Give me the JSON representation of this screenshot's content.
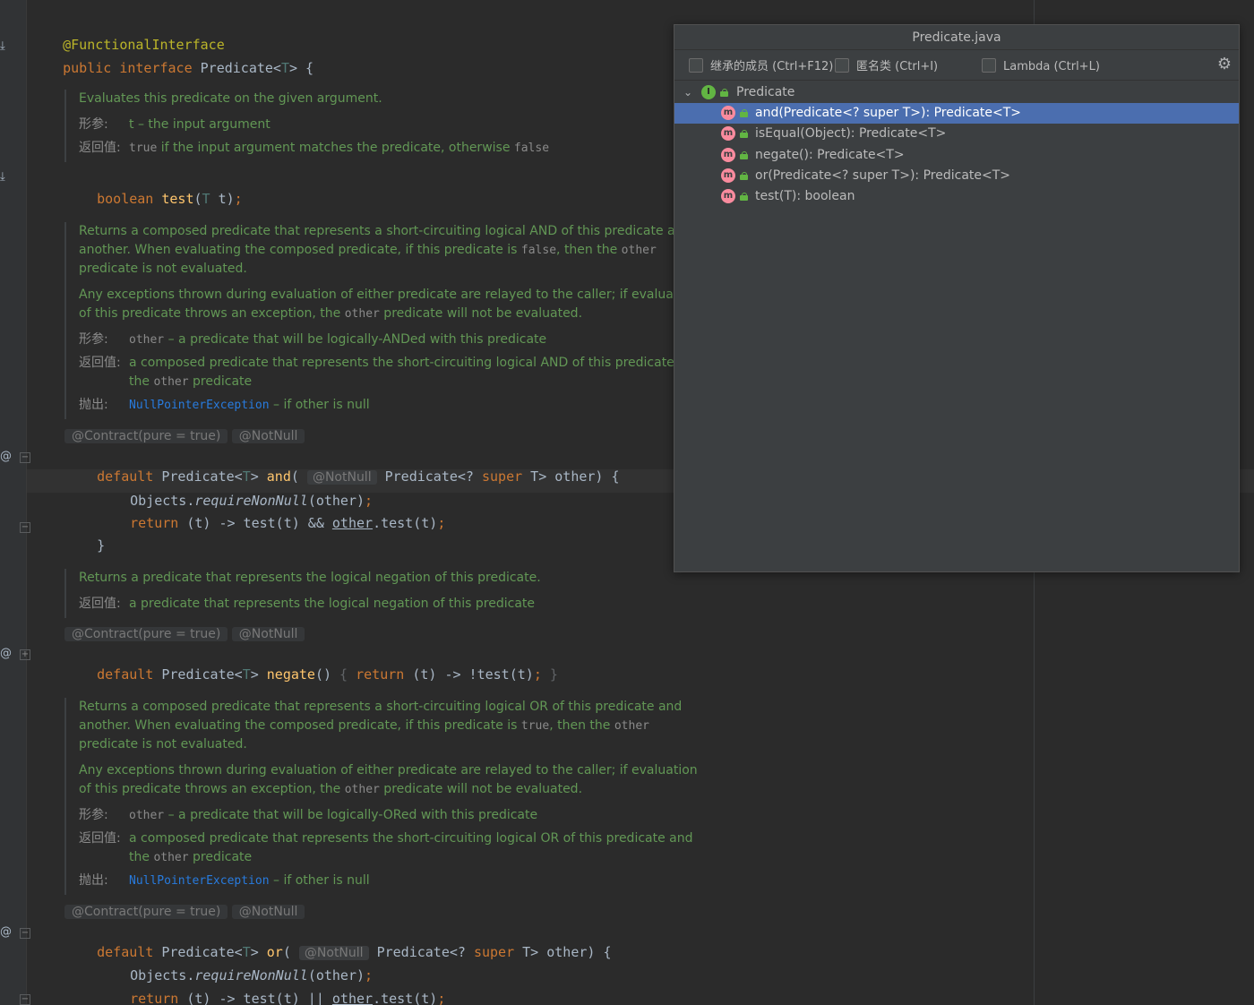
{
  "editor": {
    "line_annotation": "@FunctionalInterface",
    "decl": {
      "kw1": "public",
      "kw2": "interface",
      "name": "Predicate<",
      "tparam": "T",
      "rest": "> {"
    },
    "doc_test": {
      "desc": "Evaluates this predicate on the given argument.",
      "param_tag": "形参:",
      "param_text": "t – the input argument",
      "return_tag": "返回值:",
      "return_code1": "true",
      "return_mid": " if the input argument matches the predicate, otherwise ",
      "return_code2": "false"
    },
    "test_sig": {
      "kw": "boolean",
      "name": "test",
      "open": "(",
      "tparam": "T",
      "rest": " t)",
      "semi": ";"
    },
    "doc_and": {
      "p1a": "Returns a composed predicate that represents a short-circuiting logical AND of this predicate and",
      "p1b_pre": "another. When evaluating the composed predicate, if this predicate is ",
      "p1b_code": "false",
      "p1b_mid": ", then the ",
      "p1b_code2": "other",
      "p1c": "predicate is not evaluated.",
      "p2a": "Any exceptions thrown during evaluation of either predicate are relayed to the caller; if evaluation",
      "p2b_pre": "of this predicate throws an exception, the ",
      "p2b_code": "other",
      "p2b_post": " predicate will not be evaluated.",
      "param_tag": "形参:",
      "param_code": "other",
      "param_text": " – a predicate that will be logically-ANDed with this predicate",
      "return_tag": "返回值:",
      "return_text": "a composed predicate that represents the short-circuiting logical AND of this predicate and",
      "return_cont_pre": "the ",
      "return_cont_code": "other",
      "return_cont_post": " predicate",
      "throws_tag": "抛出:",
      "throws_link": "NullPointerException",
      "throws_text": " – if other is null"
    },
    "inlay_contract": "@Contract(pure = true)",
    "inlay_notnull": "@NotNull",
    "and_sig": {
      "kw": "default",
      "type": "Predicate<",
      "tparam": "T",
      "close": "> ",
      "name": "and",
      "open": "( ",
      "param_type": " Predicate<? ",
      "kw_super": "super",
      "rest": " T> other) {"
    },
    "and_body1": {
      "pre": "Objects.",
      "method": "requireNonNull",
      "post": "(other)",
      "semi": ";"
    },
    "and_body2": {
      "kw": "return",
      "pre": " (t) -> test(t) && ",
      "ref": "other",
      "post": ".test(t)",
      "semi": ";"
    },
    "close_brace": "}",
    "doc_negate": {
      "desc": "Returns a predicate that represents the logical negation of this predicate.",
      "return_tag": "返回值:",
      "return_text": "a predicate that represents the logical negation of this predicate"
    },
    "negate_sig": {
      "kw": "default",
      "type": "Predicate<",
      "tparam": "T",
      "close": "> ",
      "name": "negate",
      "parens": "()",
      "fold_open": " { ",
      "kw_return": "return",
      "body": " (t) -> !test(t)",
      "semi": ";",
      "fold_close": " }"
    },
    "doc_or": {
      "p1a": "Returns a composed predicate that represents a short-circuiting logical OR of this predicate and",
      "p1b_pre": "another. When evaluating the composed predicate, if this predicate is ",
      "p1b_code": "true",
      "p1b_mid": ", then the ",
      "p1b_code2": "other",
      "p1c": "predicate is not evaluated.",
      "p2a": "Any exceptions thrown during evaluation of either predicate are relayed to the caller; if evaluation",
      "p2b_pre": "of this predicate throws an exception, the ",
      "p2b_code": "other",
      "p2b_post": " predicate will not be evaluated.",
      "param_tag": "形参:",
      "param_code": "other",
      "param_text": " – a predicate that will be logically-ORed with this predicate",
      "return_tag": "返回值:",
      "return_text": "a composed predicate that represents the short-circuiting logical OR of this predicate and",
      "return_cont_pre": "the ",
      "return_cont_code": "other",
      "return_cont_post": " predicate",
      "throws_tag": "抛出:",
      "throws_link": "NullPointerException",
      "throws_text": " – if other is null"
    },
    "or_sig": {
      "kw": "default",
      "type": "Predicate<",
      "tparam": "T",
      "close": "> ",
      "name": "or",
      "open": "( ",
      "param_type": " Predicate<? ",
      "kw_super": "super",
      "rest": " T> other) {"
    },
    "or_body1": {
      "pre": "Objects.",
      "method": "requireNonNull",
      "post": "(other)",
      "semi": ";"
    },
    "or_body2": {
      "kw": "return",
      "pre": " (t) -> test(t) || ",
      "ref": "other",
      "post": ".test(t)",
      "semi": ";"
    }
  },
  "popup": {
    "title": "Predicate.java",
    "options": [
      {
        "label": "继承的成员 (Ctrl+F12)",
        "checked": false
      },
      {
        "label": "匿名类 (Ctrl+I)",
        "checked": false
      },
      {
        "label": "Lambda (Ctrl+L)",
        "checked": false
      }
    ],
    "settings_icon": "gear-icon",
    "root": {
      "icon": "interface-icon",
      "label": "Predicate",
      "expanded": true
    },
    "members": [
      {
        "icon": "method-icon",
        "label": "and(Predicate<? super T>): Predicate<T>",
        "selected": true
      },
      {
        "icon": "method-icon",
        "label": "isEqual(Object): Predicate<T>",
        "selected": false
      },
      {
        "icon": "method-icon",
        "label": "negate(): Predicate<T>",
        "selected": false
      },
      {
        "icon": "method-icon",
        "label": "or(Predicate<? super T>): Predicate<T>",
        "selected": false
      },
      {
        "icon": "method-icon",
        "label": "test(T): boolean",
        "selected": false
      }
    ],
    "colors": {
      "selection": "#4b6eaf",
      "interface_icon": "#62b543",
      "method_icon": "#f98b9e"
    }
  }
}
